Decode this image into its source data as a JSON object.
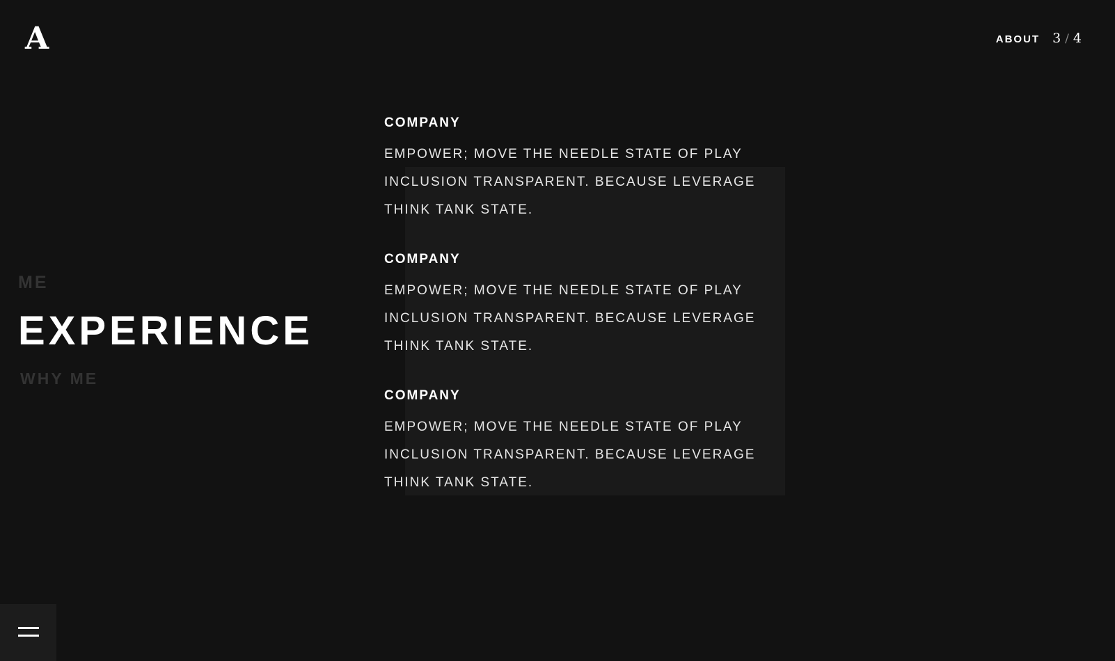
{
  "header": {
    "logo": "A",
    "nav_link": "ABOUT",
    "page_current": "3",
    "page_separator": "/",
    "page_total": "4"
  },
  "sections": {
    "previous": "ME",
    "current": "EXPERIENCE",
    "next": "WHY ME"
  },
  "entries": [
    {
      "title": "COMPANY",
      "text": "EMPOWER; MOVE THE NEEDLE STATE OF PLAY INCLUSION TRANSPARENT. BECAUSE LEVERAGE THINK TANK STATE."
    },
    {
      "title": "COMPANY",
      "text": "EMPOWER; MOVE THE NEEDLE STATE OF PLAY INCLUSION TRANSPARENT. BECAUSE LEVERAGE THINK TANK STATE."
    },
    {
      "title": "COMPANY",
      "text": "EMPOWER; MOVE THE NEEDLE STATE OF PLAY INCLUSION TRANSPARENT. BECAUSE LEVERAGE THINK TANK STATE."
    }
  ],
  "menu": {
    "icon": "hamburger-menu-icon"
  },
  "colors": {
    "background": "#121212",
    "accent_box": "#1a1a1a",
    "text_primary": "#ffffff",
    "text_muted": "#333333",
    "menu_button_bg": "#1c1c1c"
  }
}
